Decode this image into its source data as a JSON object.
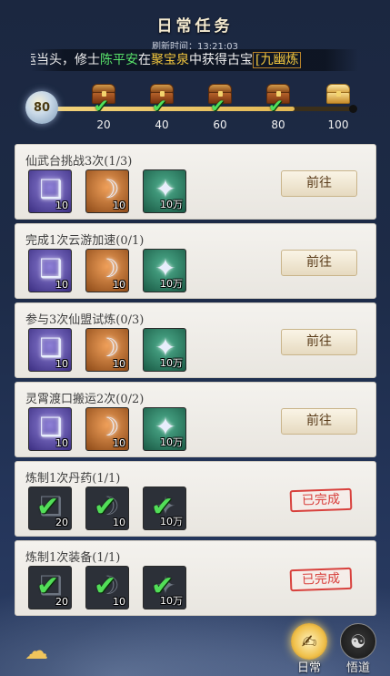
{
  "header": {
    "title": "日常任务",
    "refresh_label": "刷新时间：13:21:03"
  },
  "marquee": {
    "part1": "运当头，修士",
    "name": "陈平安",
    "part2": "在",
    "place": "聚宝泉",
    "part3": "中获得古宝",
    "item": "[九幽炼"
  },
  "progress": {
    "current": "80",
    "fraction": 0.8,
    "milestones": [
      {
        "label": "20",
        "claimed": true
      },
      {
        "label": "40",
        "claimed": true
      },
      {
        "label": "60",
        "claimed": true
      },
      {
        "label": "80",
        "claimed": true
      },
      {
        "label": "100",
        "claimed": false
      }
    ]
  },
  "tasks": [
    {
      "name": "仙武台挑战3次(1/3)",
      "action": "前往",
      "done": false,
      "rewards": [
        {
          "icon": "scroll-icon",
          "qty": "10"
        },
        {
          "icon": "crescent-icon",
          "qty": "10"
        },
        {
          "icon": "spirit-orb-icon",
          "qty": "10万"
        }
      ]
    },
    {
      "name": "完成1次云游加速(0/1)",
      "action": "前往",
      "done": false,
      "rewards": [
        {
          "icon": "scroll-icon",
          "qty": "10"
        },
        {
          "icon": "crescent-icon",
          "qty": "10"
        },
        {
          "icon": "spirit-orb-icon",
          "qty": "10万"
        }
      ]
    },
    {
      "name": "参与3次仙盟试炼(0/3)",
      "action": "前往",
      "done": false,
      "rewards": [
        {
          "icon": "scroll-icon",
          "qty": "10"
        },
        {
          "icon": "crescent-icon",
          "qty": "10"
        },
        {
          "icon": "spirit-orb-icon",
          "qty": "10万"
        }
      ]
    },
    {
      "name": "灵霄渡口搬运2次(0/2)",
      "action": "前往",
      "done": false,
      "rewards": [
        {
          "icon": "scroll-icon",
          "qty": "10"
        },
        {
          "icon": "crescent-icon",
          "qty": "10"
        },
        {
          "icon": "spirit-orb-icon",
          "qty": "10万"
        }
      ]
    },
    {
      "name": "炼制1次丹药(1/1)",
      "action": "已完成",
      "done": true,
      "rewards": [
        {
          "icon": "scroll-icon",
          "qty": "20"
        },
        {
          "icon": "crescent-icon",
          "qty": "10"
        },
        {
          "icon": "spirit-orb-icon",
          "qty": "10万"
        }
      ]
    },
    {
      "name": "炼制1次装备(1/1)",
      "action": "已完成",
      "done": true,
      "rewards": [
        {
          "icon": "scroll-icon",
          "qty": "20"
        },
        {
          "icon": "crescent-icon",
          "qty": "10"
        },
        {
          "icon": "spirit-orb-icon",
          "qty": "10万"
        }
      ]
    }
  ],
  "nav": {
    "daily_label": "日常",
    "enlight_label": "悟道"
  }
}
